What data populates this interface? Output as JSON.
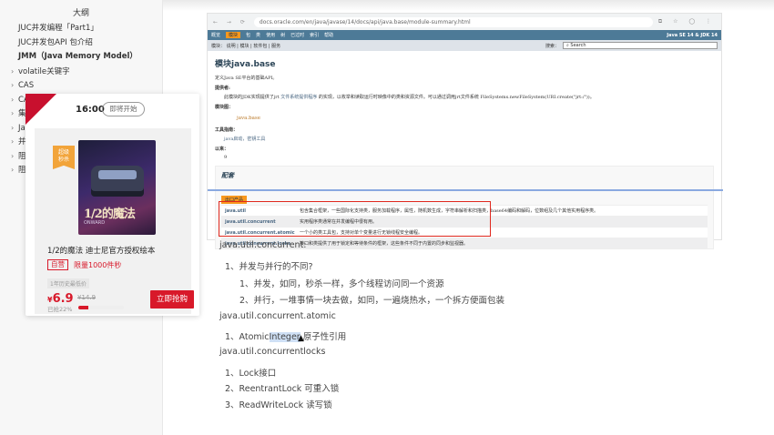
{
  "sidebar": {
    "title": "大纲",
    "items": [
      {
        "label": "JUC并发编程「Part1」",
        "kind": "top"
      },
      {
        "label": "JUC并发包API 包介绍",
        "kind": "top"
      },
      {
        "label": "JMM（Java Memory Model）",
        "kind": "bold"
      },
      {
        "label": "volatile关键字",
        "kind": "child"
      },
      {
        "label": "CAS",
        "kind": "child"
      },
      {
        "label": "CA",
        "kind": "child"
      },
      {
        "label": "集",
        "kind": "child"
      },
      {
        "label": "Ja",
        "kind": "child"
      },
      {
        "label": "并",
        "kind": "child"
      },
      {
        "label": "阻",
        "kind": "child"
      },
      {
        "label": "阻",
        "kind": "child"
      }
    ]
  },
  "browser": {
    "url": "docs.oracle.com/en/java/javase/14/docs/api/java.base/module-summary.html",
    "nav": [
      "概览",
      "模块",
      "包",
      "类",
      "使用",
      "树",
      "已过时",
      "索引",
      "帮助"
    ],
    "nav_active": "模块",
    "version": "Java SE 14 & JDK 14",
    "subnav": "模块：  说明 | 模块 | 软件包 | 服务",
    "search_label": "搜索：",
    "search_placeholder": "Search",
    "heading": "模块java.base",
    "desc": "定义Java SE平台的基础API。",
    "provider_label": "提供者:",
    "provider_text": "此模块的JDK实现提供了jrt",
    "provider_link": "文件系统提供程序",
    "provider_rest": "的实现，以枚举和读取运行时映像中的类和资源文件。可以通过调用jrt文件系统 FileSystems.newFileSystem(URI.create(\"jrt:/\"))。",
    "graph_label": "模块图：",
    "graph_value": "java.base",
    "tools_label": "工具指南：",
    "tools_value": "java启动，密钥工具",
    "since_label": "以来：",
    "since_value": "9",
    "config_heading": "配套",
    "export_tab": "出口产品",
    "packages": [
      {
        "name": "java.util",
        "desc": "包含集合框架，一些国际化支持类，服务加载程序，属性，随机数生成，字符串解析和扫描类，base64编码和解码，位数组及几个其他实用程序类。"
      },
      {
        "name": "java.util.concurrent",
        "desc": "实用程序类通常在并发编程中很有用。"
      },
      {
        "name": "java.util.concurrent.atomic",
        "desc": "一个小的类工具包，支持对单个变量进行无锁线程安全编程。"
      },
      {
        "name": "java.util.concurrent.locks",
        "desc": "接口和类提供了用于锁定和等待条件的框架，这些条件不同于内置的同步和监视器。"
      }
    ]
  },
  "notes": {
    "h1": "java.util.concurrent:",
    "q1": "1、并发与并行的不同?",
    "q1a": "1、并发，如同，秒杀一样，多个线程访问同一个资源",
    "q1b": "2、并行，一堆事情一块去做，如同，一遍烧热水，一个拆方便面包装",
    "h2": "java.util.concurrent.atomic",
    "a1_pre": "1、Atomic",
    "a1_hl": "Integer",
    "a1_post": " 原子性引用",
    "h3": "java.util.concurrentlocks",
    "l1": "1、Lock接口",
    "l2": "2、ReentrantLock 可重入锁",
    "l3": "3、ReadWriteLock 读写锁"
  },
  "ad": {
    "time": "16:00",
    "pill": "即将开始",
    "badge_line1": "超级",
    "badge_line2": "秒杀",
    "cover_title": "1/2的魔法",
    "cover_sub": "ONWARD",
    "product_name": "1/2的魔法 迪士尼官方授权绘本",
    "self_tag": "自营",
    "limit": "限量1000件秒",
    "lowest": "1年历史最低价",
    "price_symbol": "¥",
    "price": "6.9",
    "orig_price": "¥14.9",
    "sold": "已抢22%",
    "sold_fraction": 0.22,
    "buy": "立即抢购",
    "accent": "#d8192a"
  }
}
